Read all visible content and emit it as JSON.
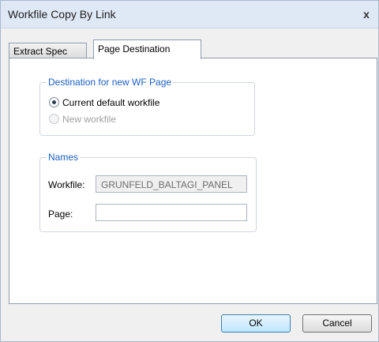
{
  "window": {
    "title": "Workfile Copy By Link",
    "close_label": "x"
  },
  "tabs": [
    {
      "label": "Extract Spec",
      "active": false
    },
    {
      "label": "Page Destination",
      "active": true
    }
  ],
  "destination_group": {
    "title": "Destination for new WF Page",
    "options": [
      {
        "label": "Current default workfile",
        "selected": true,
        "enabled": true
      },
      {
        "label": "New workfile",
        "selected": false,
        "enabled": false
      }
    ]
  },
  "names_group": {
    "title": "Names",
    "workfile_label": "Workfile:",
    "workfile_value": "GRUNFELD_BALTAGI_PANEL",
    "page_label": "Page:",
    "page_value": ""
  },
  "buttons": {
    "ok": "OK",
    "cancel": "Cancel"
  }
}
